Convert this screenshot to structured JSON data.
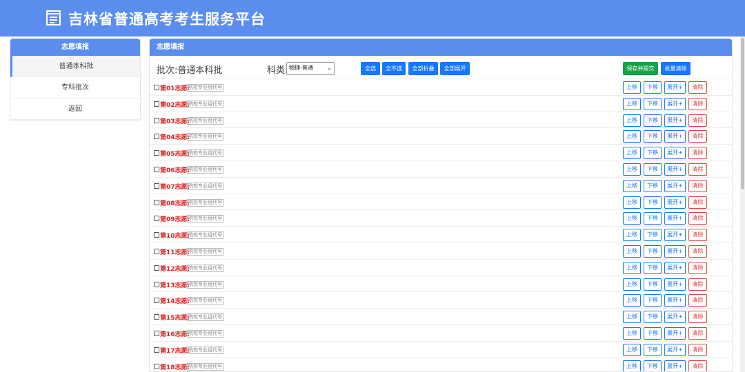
{
  "app": {
    "title": "吉林省普通高考考生服务平台"
  },
  "sidebar": {
    "title": "志愿填报",
    "items": [
      {
        "label": "普通本科批",
        "active": true
      },
      {
        "label": "专科批次",
        "active": false
      },
      {
        "label": "返回",
        "active": false
      }
    ]
  },
  "main": {
    "title": "志愿填报",
    "batch": "批次:普通本科批",
    "subject_label": "科类:",
    "subject_value": "物理-普通",
    "buttons": {
      "select_all": "全选",
      "select_none": "全不选",
      "collapse_all": "全部折叠",
      "expand_all": "全部展开",
      "save_submit": "保存并提交",
      "batch_clear": "批量清除"
    },
    "row_actions": {
      "up": "上移",
      "down": "下移",
      "expand": "展开+",
      "clear": "清除"
    },
    "code_placeholder": "院校专业组代号",
    "rows": [
      "第01志愿:",
      "第02志愿:",
      "第03志愿:",
      "第04志愿:",
      "第05志愿:",
      "第06志愿:",
      "第07志愿:",
      "第08志愿:",
      "第09志愿:",
      "第10志愿:",
      "第11志愿:",
      "第12志愿:",
      "第13志愿:",
      "第14志愿:",
      "第15志愿:",
      "第16志愿:",
      "第17志愿:",
      "第18志愿:"
    ]
  },
  "colors": {
    "brand": "#5b8def",
    "primary_button": "#1677ff",
    "success_button": "#16a34a",
    "danger": "#e53e3e",
    "choice_label": "#e01e1e"
  },
  "icons": {
    "logo": "document-icon",
    "select_arrow": "chevron-down-icon"
  }
}
